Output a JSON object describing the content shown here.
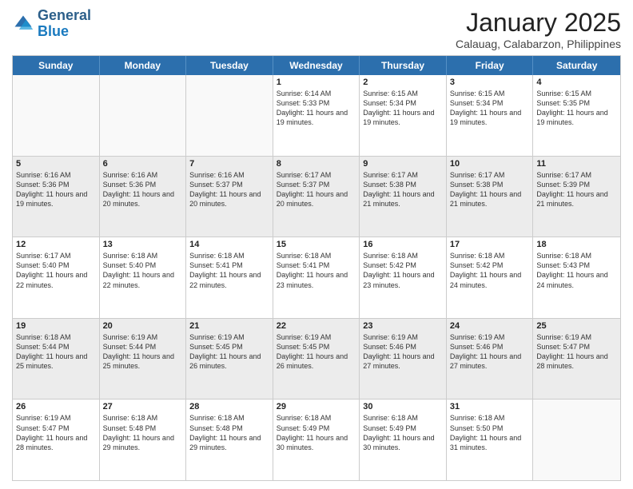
{
  "header": {
    "logo_general": "General",
    "logo_blue": "Blue",
    "month_title": "January 2025",
    "location": "Calauag, Calabarzon, Philippines"
  },
  "weekdays": [
    "Sunday",
    "Monday",
    "Tuesday",
    "Wednesday",
    "Thursday",
    "Friday",
    "Saturday"
  ],
  "rows": [
    [
      {
        "day": "",
        "info": ""
      },
      {
        "day": "",
        "info": ""
      },
      {
        "day": "",
        "info": ""
      },
      {
        "day": "1",
        "info": "Sunrise: 6:14 AM\nSunset: 5:33 PM\nDaylight: 11 hours and 19 minutes."
      },
      {
        "day": "2",
        "info": "Sunrise: 6:15 AM\nSunset: 5:34 PM\nDaylight: 11 hours and 19 minutes."
      },
      {
        "day": "3",
        "info": "Sunrise: 6:15 AM\nSunset: 5:34 PM\nDaylight: 11 hours and 19 minutes."
      },
      {
        "day": "4",
        "info": "Sunrise: 6:15 AM\nSunset: 5:35 PM\nDaylight: 11 hours and 19 minutes."
      }
    ],
    [
      {
        "day": "5",
        "info": "Sunrise: 6:16 AM\nSunset: 5:36 PM\nDaylight: 11 hours and 19 minutes."
      },
      {
        "day": "6",
        "info": "Sunrise: 6:16 AM\nSunset: 5:36 PM\nDaylight: 11 hours and 20 minutes."
      },
      {
        "day": "7",
        "info": "Sunrise: 6:16 AM\nSunset: 5:37 PM\nDaylight: 11 hours and 20 minutes."
      },
      {
        "day": "8",
        "info": "Sunrise: 6:17 AM\nSunset: 5:37 PM\nDaylight: 11 hours and 20 minutes."
      },
      {
        "day": "9",
        "info": "Sunrise: 6:17 AM\nSunset: 5:38 PM\nDaylight: 11 hours and 21 minutes."
      },
      {
        "day": "10",
        "info": "Sunrise: 6:17 AM\nSunset: 5:38 PM\nDaylight: 11 hours and 21 minutes."
      },
      {
        "day": "11",
        "info": "Sunrise: 6:17 AM\nSunset: 5:39 PM\nDaylight: 11 hours and 21 minutes."
      }
    ],
    [
      {
        "day": "12",
        "info": "Sunrise: 6:17 AM\nSunset: 5:40 PM\nDaylight: 11 hours and 22 minutes."
      },
      {
        "day": "13",
        "info": "Sunrise: 6:18 AM\nSunset: 5:40 PM\nDaylight: 11 hours and 22 minutes."
      },
      {
        "day": "14",
        "info": "Sunrise: 6:18 AM\nSunset: 5:41 PM\nDaylight: 11 hours and 22 minutes."
      },
      {
        "day": "15",
        "info": "Sunrise: 6:18 AM\nSunset: 5:41 PM\nDaylight: 11 hours and 23 minutes."
      },
      {
        "day": "16",
        "info": "Sunrise: 6:18 AM\nSunset: 5:42 PM\nDaylight: 11 hours and 23 minutes."
      },
      {
        "day": "17",
        "info": "Sunrise: 6:18 AM\nSunset: 5:42 PM\nDaylight: 11 hours and 24 minutes."
      },
      {
        "day": "18",
        "info": "Sunrise: 6:18 AM\nSunset: 5:43 PM\nDaylight: 11 hours and 24 minutes."
      }
    ],
    [
      {
        "day": "19",
        "info": "Sunrise: 6:18 AM\nSunset: 5:44 PM\nDaylight: 11 hours and 25 minutes."
      },
      {
        "day": "20",
        "info": "Sunrise: 6:19 AM\nSunset: 5:44 PM\nDaylight: 11 hours and 25 minutes."
      },
      {
        "day": "21",
        "info": "Sunrise: 6:19 AM\nSunset: 5:45 PM\nDaylight: 11 hours and 26 minutes."
      },
      {
        "day": "22",
        "info": "Sunrise: 6:19 AM\nSunset: 5:45 PM\nDaylight: 11 hours and 26 minutes."
      },
      {
        "day": "23",
        "info": "Sunrise: 6:19 AM\nSunset: 5:46 PM\nDaylight: 11 hours and 27 minutes."
      },
      {
        "day": "24",
        "info": "Sunrise: 6:19 AM\nSunset: 5:46 PM\nDaylight: 11 hours and 27 minutes."
      },
      {
        "day": "25",
        "info": "Sunrise: 6:19 AM\nSunset: 5:47 PM\nDaylight: 11 hours and 28 minutes."
      }
    ],
    [
      {
        "day": "26",
        "info": "Sunrise: 6:19 AM\nSunset: 5:47 PM\nDaylight: 11 hours and 28 minutes."
      },
      {
        "day": "27",
        "info": "Sunrise: 6:18 AM\nSunset: 5:48 PM\nDaylight: 11 hours and 29 minutes."
      },
      {
        "day": "28",
        "info": "Sunrise: 6:18 AM\nSunset: 5:48 PM\nDaylight: 11 hours and 29 minutes."
      },
      {
        "day": "29",
        "info": "Sunrise: 6:18 AM\nSunset: 5:49 PM\nDaylight: 11 hours and 30 minutes."
      },
      {
        "day": "30",
        "info": "Sunrise: 6:18 AM\nSunset: 5:49 PM\nDaylight: 11 hours and 30 minutes."
      },
      {
        "day": "31",
        "info": "Sunrise: 6:18 AM\nSunset: 5:50 PM\nDaylight: 11 hours and 31 minutes."
      },
      {
        "day": "",
        "info": ""
      }
    ]
  ]
}
